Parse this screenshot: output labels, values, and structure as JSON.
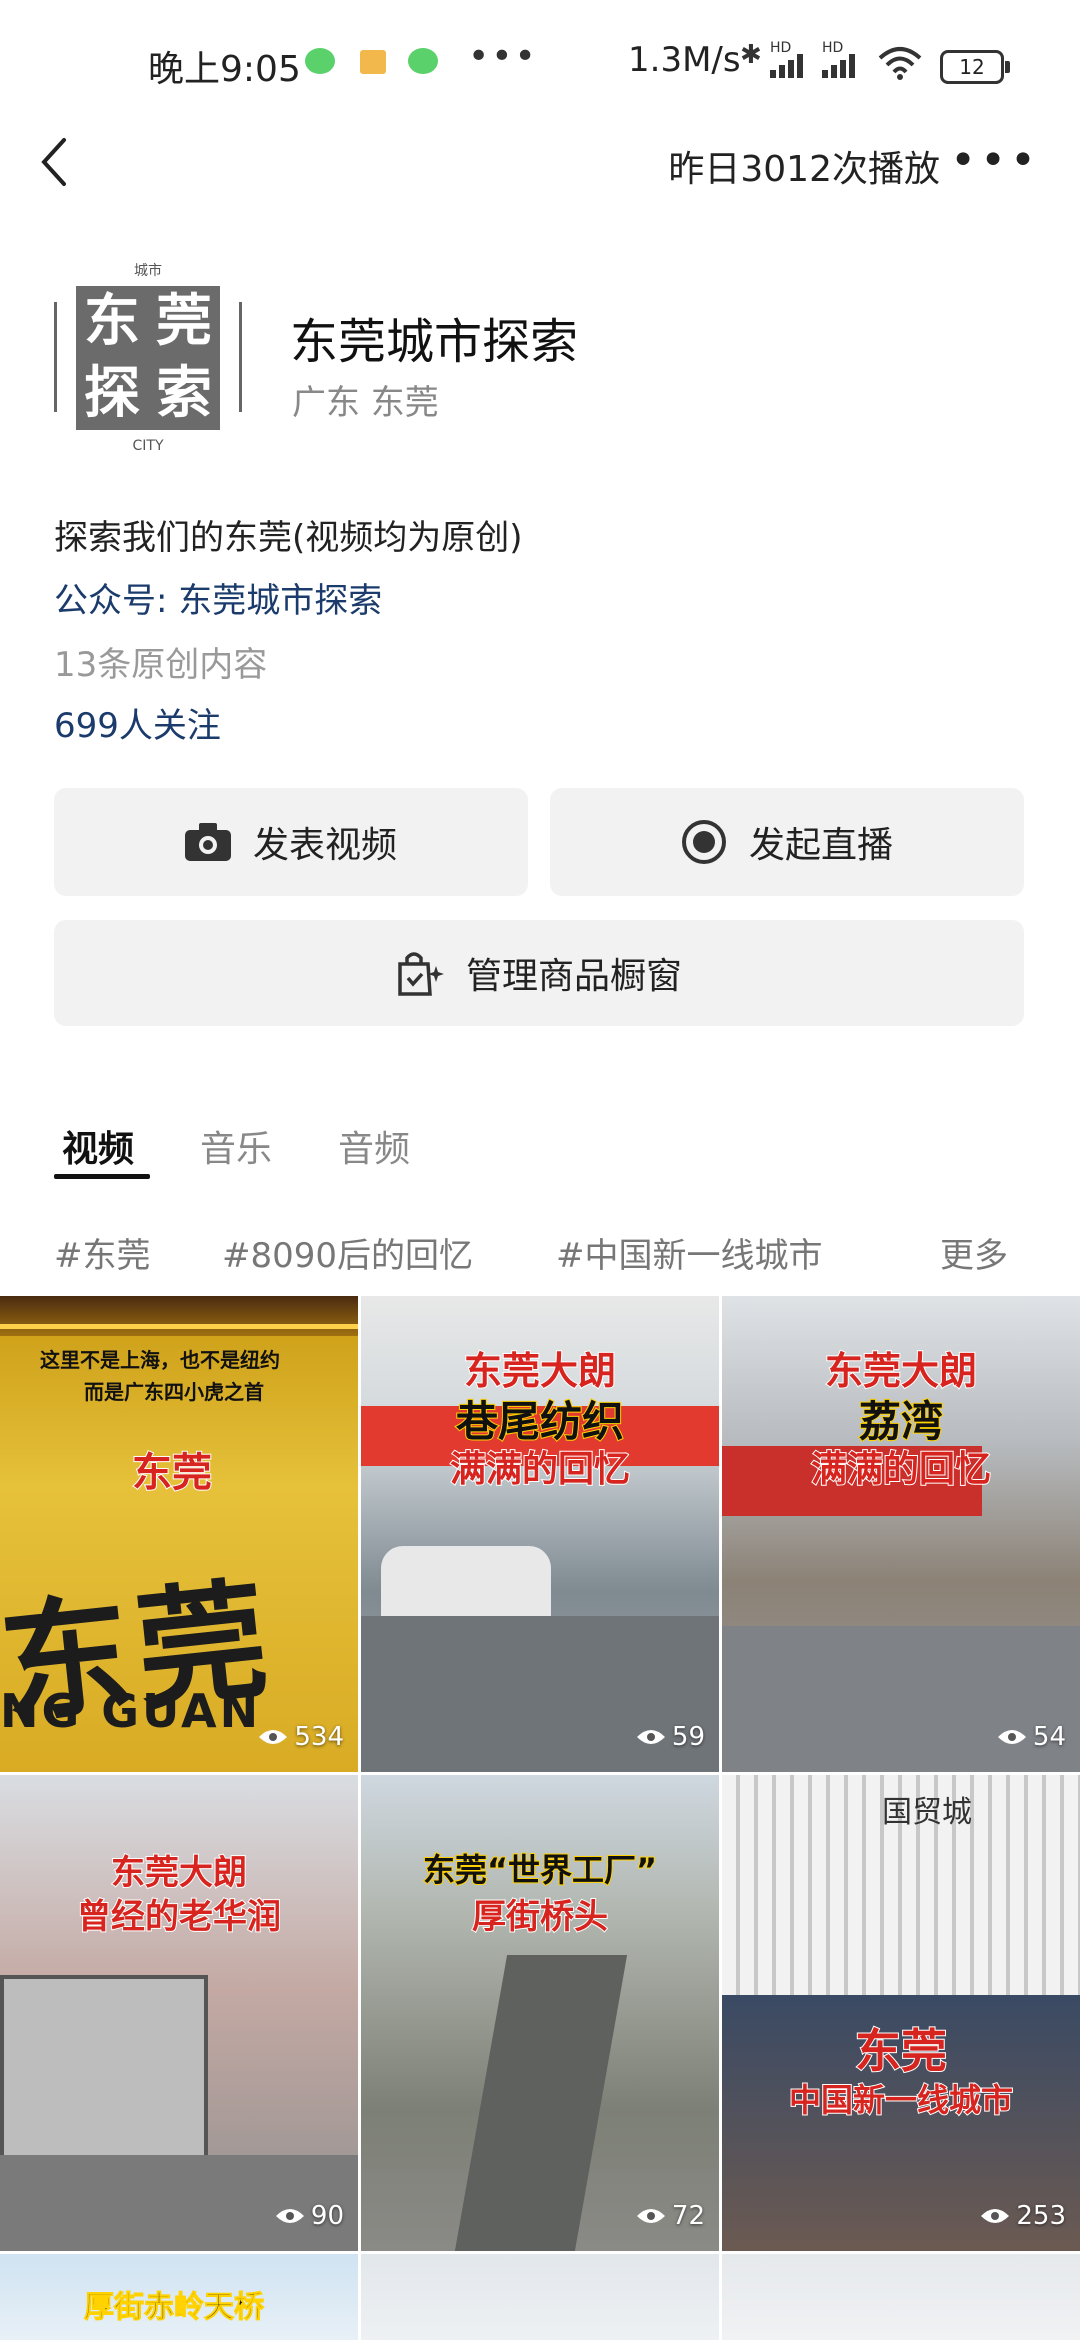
{
  "status_bar": {
    "time": "晚上9:05",
    "speed": "1.3M/s",
    "signal_1": "HD",
    "signal_2": "HD",
    "battery": "12"
  },
  "header": {
    "back_icon": "chevron-left-icon",
    "plays": "昨日3012次播放",
    "more_icon": "more-dots-icon"
  },
  "profile": {
    "logo_chars": [
      "东",
      "莞",
      "探",
      "索"
    ],
    "logo_top": "城市",
    "logo_bottom": "CITY",
    "name": "东莞城市探索",
    "region": "广东 东莞",
    "description": "探索我们的东莞(视频均为原创)",
    "gzh": "公众号: 东莞城市探索",
    "original_count": "13条原创内容",
    "followers": "699人关注"
  },
  "actions": {
    "post_video": "发表视频",
    "go_live": "发起直播",
    "manage_shop": "管理商品橱窗"
  },
  "tabs": [
    "视频",
    "音乐",
    "音频"
  ],
  "tags": [
    "#东莞",
    "#8090后的回忆",
    "#中国新一线城市",
    "更多"
  ],
  "videos": [
    {
      "title": "东莞",
      "subtitle_1": "这里不是上海，也不是纽约",
      "subtitle_2": "而是广东四小虎之首",
      "big_text": "东莞",
      "bottom_text": "NG GUAN",
      "views": "534"
    },
    {
      "title": "东莞大朗",
      "line2": "巷尾纺织",
      "line3": "满满的回忆",
      "views": "59"
    },
    {
      "title": "东莞大朗",
      "line2": "荔湾",
      "line3": "满满的回忆",
      "views": "54"
    },
    {
      "title": "东莞大朗",
      "line2": "曾经的老华润",
      "views": "90"
    },
    {
      "title": "东莞“世界工厂”",
      "line2": "厚街桥头",
      "views": "72"
    },
    {
      "title": "东莞",
      "line2": "中国新一线城市",
      "sign": "国贸城",
      "views": "253"
    },
    {
      "title": "厚街赤岭天桥"
    },
    {},
    {}
  ],
  "colors": {
    "accent_link": "#1a3b6b",
    "caption_red": "#d8241f"
  }
}
